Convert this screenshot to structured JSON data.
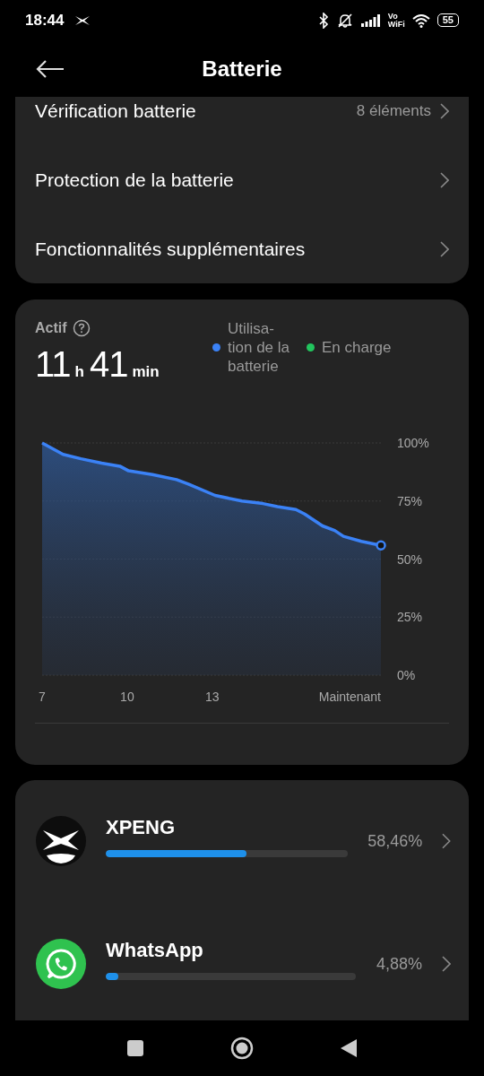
{
  "status_bar": {
    "time": "18:44",
    "vowifi_top": "Vo",
    "vowifi_bottom": "WiFi",
    "battery": "55"
  },
  "header": {
    "title": "Batterie"
  },
  "settings": [
    {
      "label": "Vérification batterie",
      "value": "8 éléments"
    },
    {
      "label": "Protection de la batterie"
    },
    {
      "label": "Fonctionnalités supplémentaires"
    }
  ],
  "usage": {
    "label": "Actif",
    "hours": "11",
    "hours_unit": "h",
    "minutes": "41",
    "minutes_unit": "min",
    "chart_data": {
      "type": "area",
      "x": [
        7,
        7.74,
        8.37,
        9.1,
        9.74,
        10.05,
        10.89,
        11.74,
        12.16,
        13.1,
        14.05,
        14.79,
        15.3,
        15.95,
        16.26,
        16.89,
        17.32,
        17.63,
        18.26,
        18.95
      ],
      "series": [
        {
          "name": "Utilisa-tion de la batterie",
          "color": "#3b82f6",
          "values": [
            100,
            95.1,
            93.2,
            91.3,
            90,
            88,
            86.4,
            84.2,
            82.3,
            77.4,
            75,
            73.9,
            72.6,
            71.3,
            69.4,
            64.3,
            62.3,
            59.8,
            57.6,
            55.9
          ]
        },
        {
          "name": "En charge",
          "color": "#22c55e",
          "values": [
            null,
            null,
            null,
            null,
            null,
            null,
            null,
            null,
            null,
            null,
            null,
            null,
            null,
            null,
            null,
            null,
            null,
            null,
            null,
            null
          ]
        }
      ],
      "grid": true,
      "xlim": [
        7,
        18.95
      ],
      "ylim": [
        0,
        100
      ],
      "xticks": [
        7,
        10,
        13,
        {
          "value": 18.95,
          "label": "Maintenant"
        }
      ],
      "yticks": [
        {
          "value": 100,
          "label": "100%"
        },
        {
          "value": 75,
          "label": "75%"
        },
        {
          "value": 50,
          "label": "50%"
        },
        {
          "value": 25,
          "label": "25%"
        },
        {
          "value": 0,
          "label": "0%"
        }
      ]
    }
  },
  "apps": [
    {
      "kind": "xpeng",
      "name": "XPENG",
      "share": "58,46%",
      "level": 0.58
    },
    {
      "kind": "whatsapp",
      "name": "WhatsApp",
      "share": "4,88%",
      "level": 0.05
    }
  ]
}
